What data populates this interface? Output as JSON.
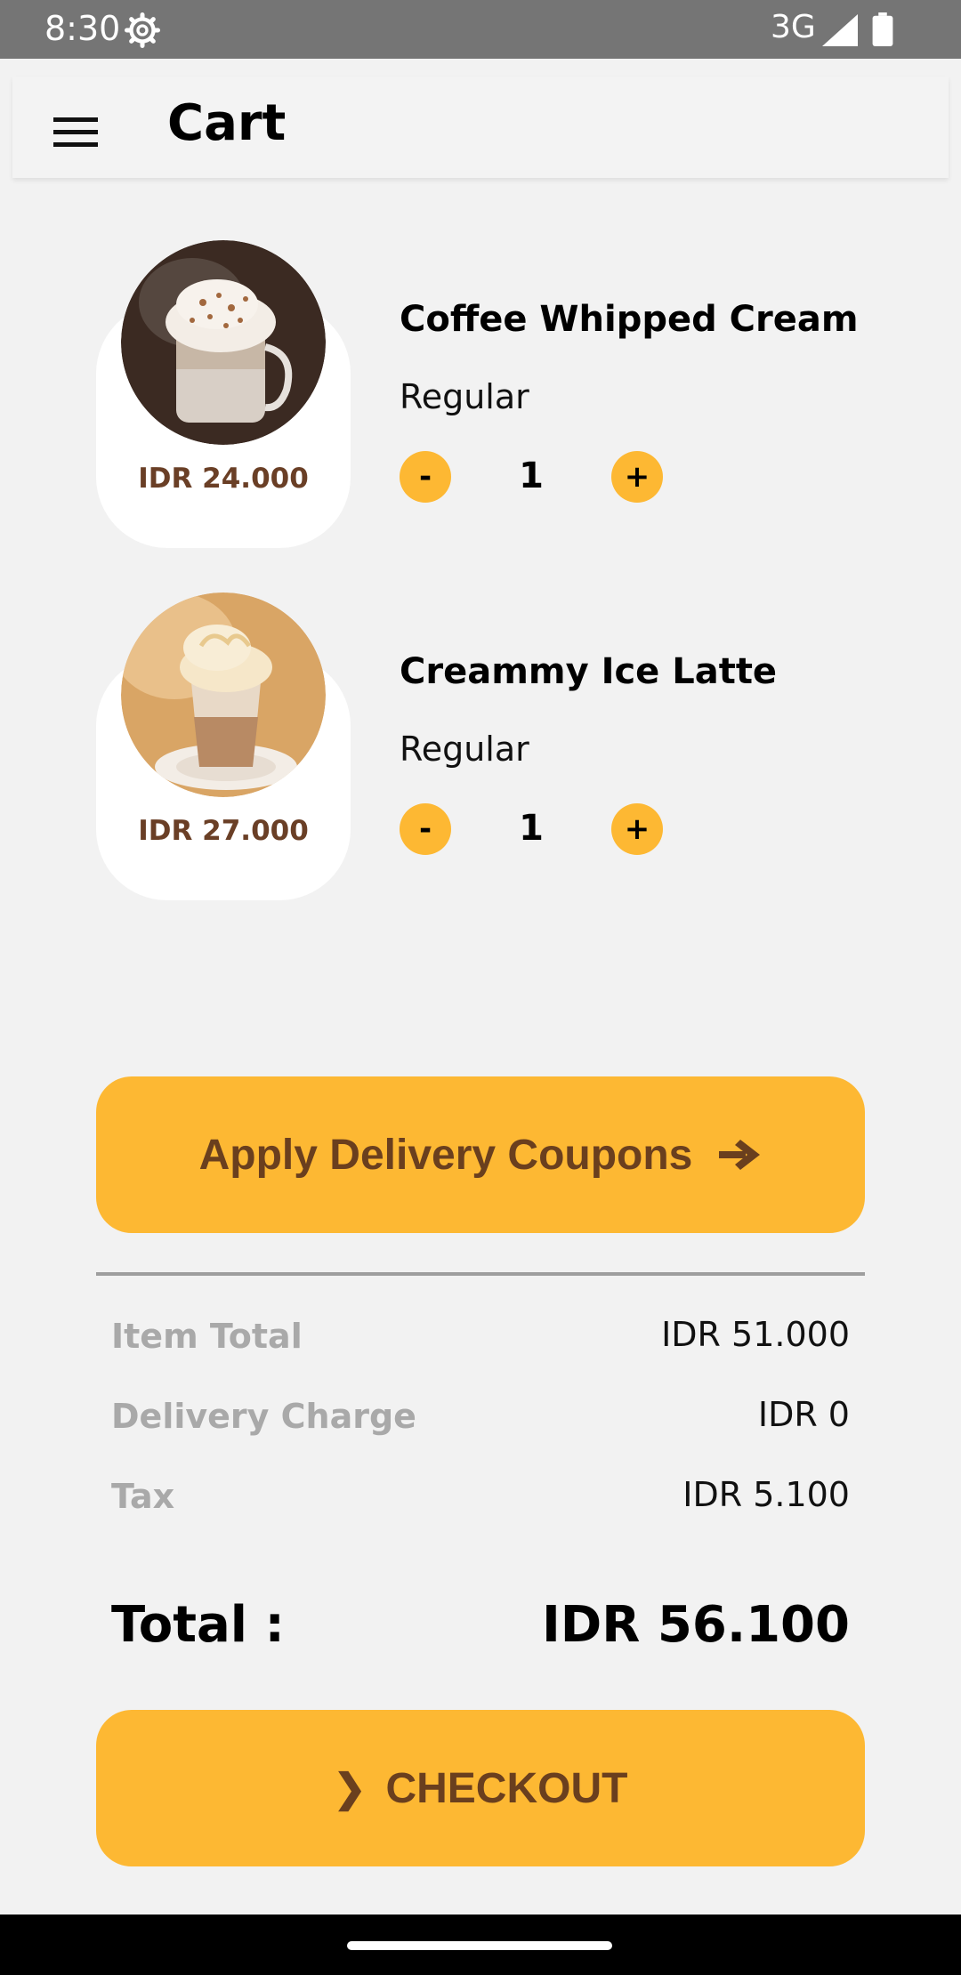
{
  "status_bar": {
    "time": "8:30",
    "network": "3G",
    "icons": [
      "settings-icon",
      "signal-icon",
      "battery-icon"
    ]
  },
  "app_bar": {
    "title": "Cart",
    "menu_icon": "hamburger-menu-icon"
  },
  "cart_items": [
    {
      "name": "Coffee Whipped Cream",
      "price": "IDR 24.000",
      "size": "Regular",
      "quantity": "1",
      "minus_label": "-",
      "plus_label": "+"
    },
    {
      "name": "Creammy Ice Latte",
      "price": "IDR 27.000",
      "size": "Regular",
      "quantity": "1",
      "minus_label": "-",
      "plus_label": "+"
    }
  ],
  "coupon_button": {
    "label": "Apply Delivery Coupons",
    "icon": "arrow-right-icon"
  },
  "summary": {
    "item_total_label": "Item Total",
    "item_total_value": "IDR 51.000",
    "delivery_label": "Delivery Charge",
    "delivery_value": "IDR 0",
    "tax_label": "Tax",
    "tax_value": "IDR 5.100"
  },
  "total": {
    "label": "Total :",
    "value": "IDR 56.100"
  },
  "checkout_button": {
    "chevron": "❯",
    "label": "CHECKOUT"
  },
  "colors": {
    "accent": "#fdb833",
    "button_text": "#6a3f1e",
    "price_text": "#6a3f26",
    "status_bar": "#757575",
    "background": "#f2f2f2"
  }
}
